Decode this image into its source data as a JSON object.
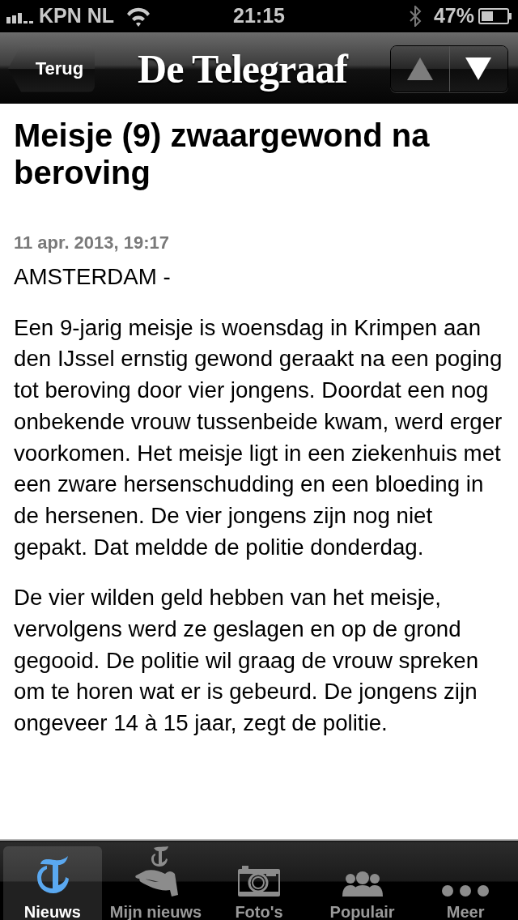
{
  "status_bar": {
    "carrier": "KPN NL",
    "time": "21:15",
    "battery": "47%"
  },
  "nav_bar": {
    "back_button": "Terug",
    "logo": "De Telegraaf",
    "arrows": [
      {
        "kind": "up",
        "disabled": true
      },
      {
        "kind": "down",
        "disabled": false
      }
    ]
  },
  "article": {
    "title": "Meisje (9) zwaargewond na beroving",
    "date": "11 apr. 2013, 19:17",
    "dateline": "AMSTERDAM -",
    "paragraphs": [
      "Een 9-jarig meisje is woensdag in Krimpen aan den IJssel ernstig gewond geraakt na een poging tot beroving door vier jongens. Doordat een nog onbekende vrouw tussenbeide kwam, werd erger voorkomen. Het meisje ligt in een ziekenhuis met een zware hersenschudding en een bloeding in de hersenen. De vier jongens zijn nog niet gepakt. Dat meldde de politie donderdag.",
      "De vier wilden geld hebben van het meisje, vervolgens werd ze geslagen en op de grond gegooid. De politie wil graag de vrouw spreken om te horen wat er is gebeurd. De jongens zijn ongeveer 14 à 15 jaar, zegt de politie."
    ]
  },
  "tab_bar": [
    {
      "label": "Nieuws",
      "selected": true
    },
    {
      "label": "Mijn nieuws",
      "selected": false
    },
    {
      "label": "Foto's",
      "selected": false
    },
    {
      "label": "Populair",
      "selected": false
    },
    {
      "label": "Meer",
      "selected": false
    }
  ]
}
